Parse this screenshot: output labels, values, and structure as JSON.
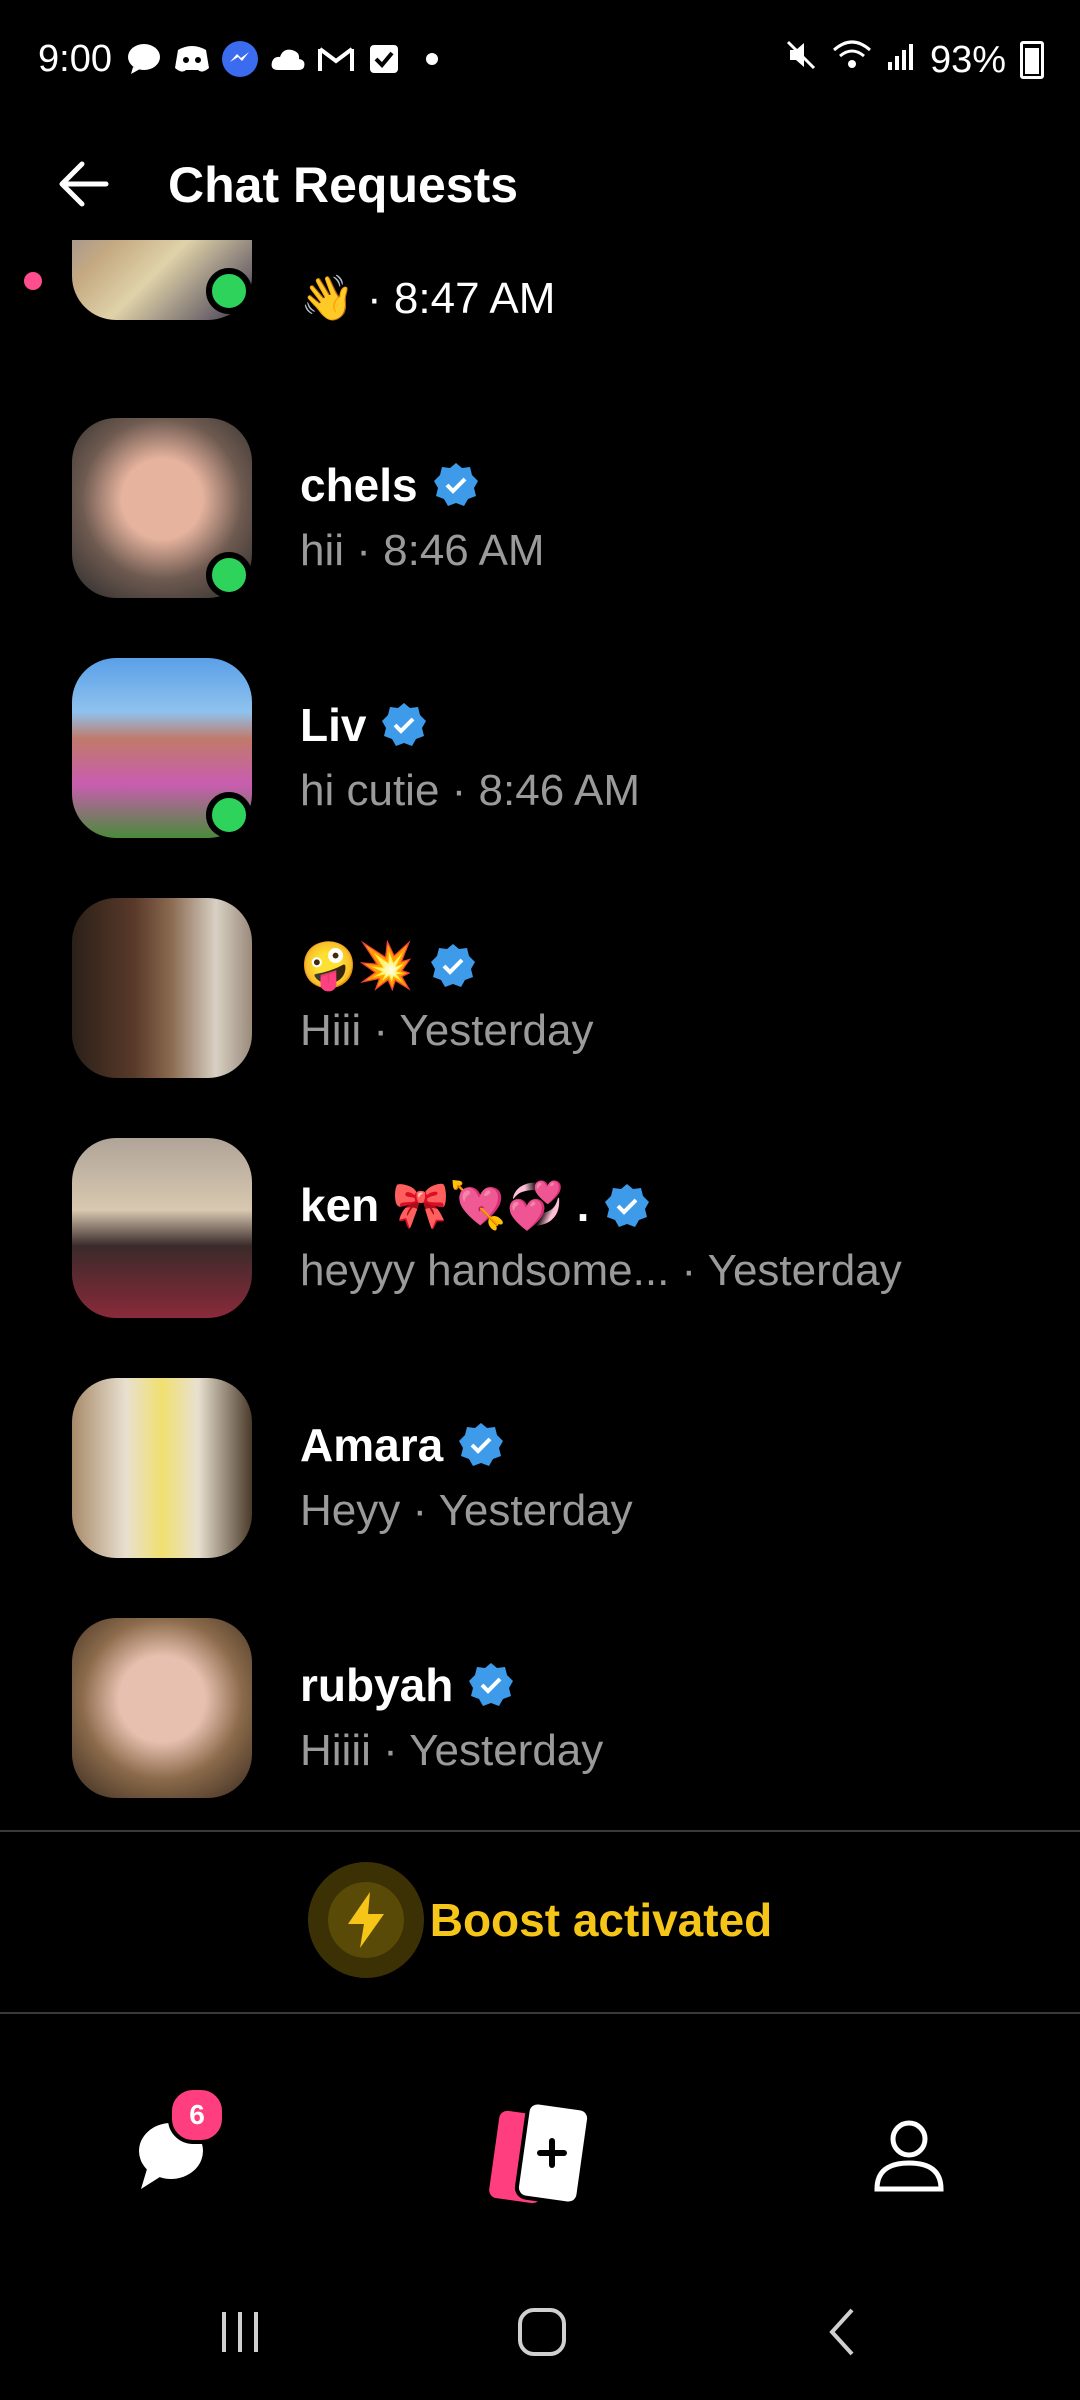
{
  "status": {
    "time": "9:00",
    "battery": "93%",
    "icons": [
      "messages-icon",
      "discord-icon",
      "messenger-icon",
      "cloud-icon",
      "gmail-icon",
      "tasks-icon",
      "dot-icon"
    ],
    "right_icons": [
      "mute-icon",
      "wifi-icon",
      "signal-icon",
      "battery-icon"
    ]
  },
  "header": {
    "title": "Chat Requests"
  },
  "requests": [
    {
      "name": "",
      "message": "👋",
      "time": "8:47 AM",
      "online": true,
      "verified": false,
      "partial": true
    },
    {
      "name": "chels",
      "message": "hii",
      "time": "8:46 AM",
      "online": true,
      "verified": true
    },
    {
      "name": "Liv",
      "message": "hi cutie",
      "time": "8:46 AM",
      "online": true,
      "verified": true
    },
    {
      "name": "🤪💥",
      "message": "Hiii",
      "time": "Yesterday",
      "online": false,
      "verified": true
    },
    {
      "name": "ken 🎀💘💞 .",
      "message": "heyyy handsome...",
      "time": "Yesterday",
      "online": false,
      "verified": true
    },
    {
      "name": "Amara",
      "message": "Heyy",
      "time": "Yesterday",
      "online": false,
      "verified": true
    },
    {
      "name": "rubyah",
      "message": "Hiiii",
      "time": "Yesterday",
      "online": false,
      "verified": true
    }
  ],
  "boost": {
    "label": "Boost activated"
  },
  "nav": {
    "chats_badge": "6"
  },
  "colors": {
    "accent": "#f5c518",
    "pink": "#ff3e7f",
    "online": "#2ed35b",
    "verified": "#3d9be9"
  }
}
